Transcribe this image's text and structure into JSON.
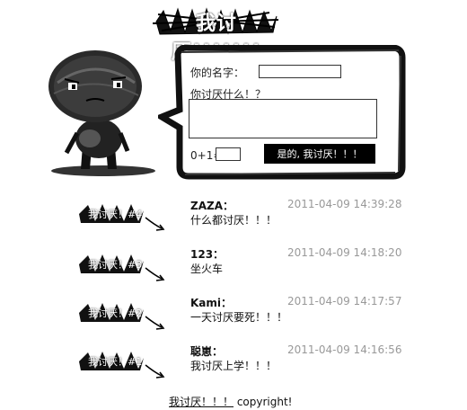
{
  "header": {
    "title": "我讨厌!!!!!!!"
  },
  "form": {
    "name_label": "你的名字：",
    "name_value": "",
    "what_label": "你讨厌什么！？",
    "what_value": "",
    "captcha_label": "0+1=",
    "captcha_value": "",
    "submit_label": "是的, 我讨厌！！！"
  },
  "comments": [
    {
      "badge": "我讨厌！#4",
      "name": "ZAZA：",
      "text": "什么都讨厌！！！",
      "time": "2011-04-09 14:39:28"
    },
    {
      "badge": "我讨厌！#3",
      "name": "123：",
      "text": "坐火车",
      "time": "2011-04-09 14:18:20"
    },
    {
      "badge": "我讨厌！#2",
      "name": "Kami：",
      "text": "一天讨厌要死！！！",
      "time": "2011-04-09 14:17:57"
    },
    {
      "badge": "我讨厌！#1",
      "name": "聪崽：",
      "text": "我讨厌上学！！！",
      "time": "2011-04-09 14:16:56"
    }
  ],
  "footer": {
    "link_label": "我讨厌！！！",
    "copyright": " copyright!"
  }
}
